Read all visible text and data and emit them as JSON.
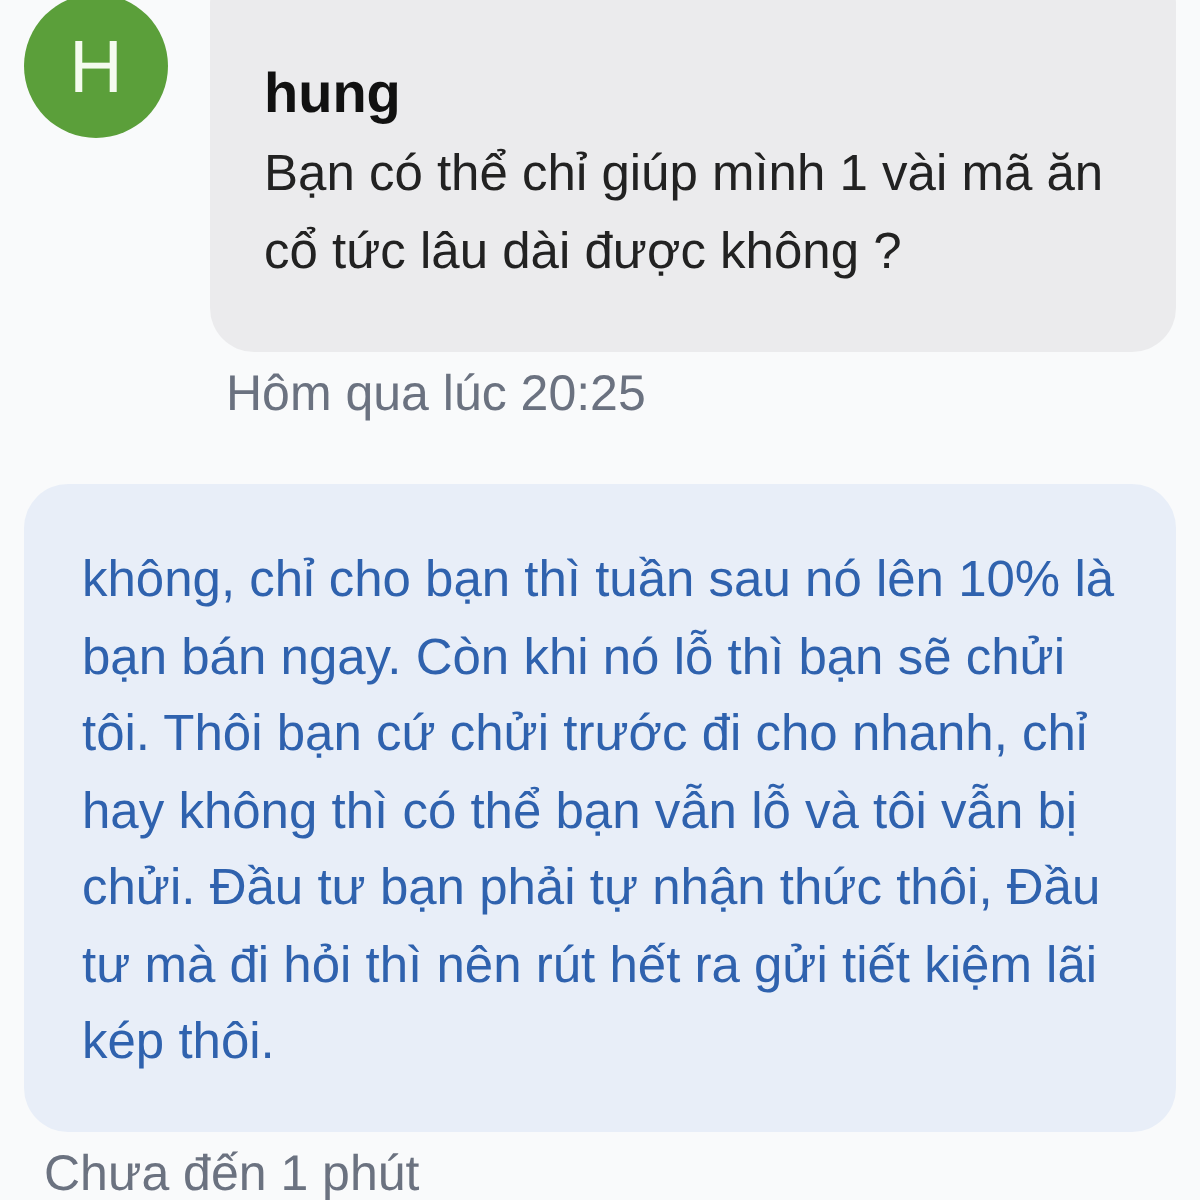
{
  "messages": [
    {
      "kind": "incoming",
      "avatar_letter": "H",
      "author": "hung",
      "text": "Bạn có thể chỉ giúp mình 1 vài mã ăn cổ tức lâu dài được không ?",
      "timestamp": "Hôm qua lúc 20:25"
    },
    {
      "kind": "outgoing",
      "text": "không, chỉ cho bạn thì tuần sau nó lên 10% là bạn bán ngay. Còn khi nó lỗ thì bạn sẽ chửi tôi. Thôi bạn cứ chửi trước đi cho nhanh, chỉ hay không thì có thể bạn vẫn lỗ và tôi vẫn bị chửi. Đầu tư bạn phải tự nhận thức thôi, Đầu tư mà đi hỏi thì nên rút hết ra gửi tiết kiệm lãi kép thôi.",
      "timestamp": "Chưa đến 1 phút"
    }
  ]
}
